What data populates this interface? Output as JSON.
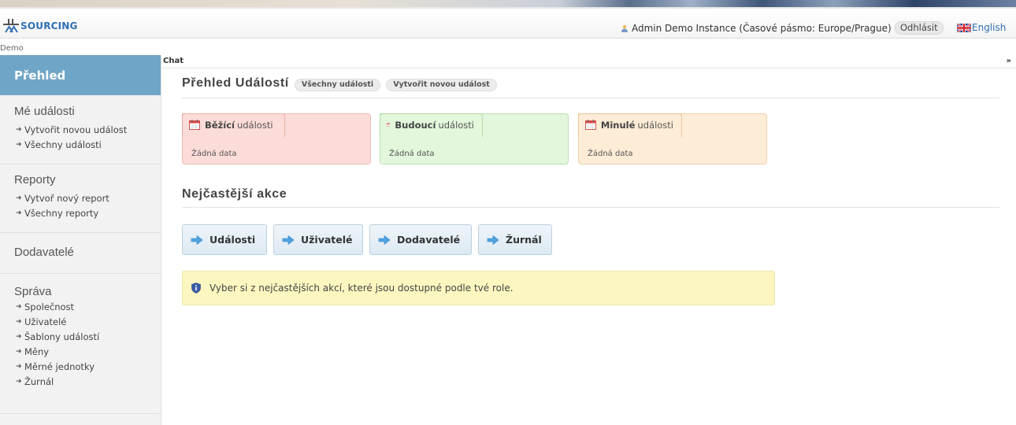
{
  "header": {
    "logo_text": "SOURCING",
    "user_info": "Admin Demo Instance (Časové pásmo: Europe/Prague)",
    "logout_label": "Odhlásit",
    "language_label": "English"
  },
  "instance_label": "Demo",
  "sidebar": {
    "overview_label": "Přehled",
    "my_events": {
      "title": "Mé události",
      "links": [
        "Vytvořit novou událost",
        "Všechny události"
      ]
    },
    "reports": {
      "title": "Reporty",
      "links": [
        "Vytvoř nový report",
        "Všechny reporty"
      ]
    },
    "suppliers": {
      "title": "Dodavatelé"
    },
    "admin": {
      "title": "Správa",
      "links": [
        "Společnost",
        "Uživatelé",
        "Šablony událostí",
        "Měny",
        "Měrné jednotky",
        "Žurnál"
      ]
    }
  },
  "chat": {
    "label": "Chat",
    "toggle": "»"
  },
  "main": {
    "title": "Přehled Událostí",
    "all_events_pill": "Všechny události",
    "create_event_pill": "Vytvořit novou událost",
    "event_boxes": {
      "running": {
        "bold": "Běžící",
        "rest": "události",
        "empty": "Žádná data"
      },
      "future": {
        "bold": "Budoucí",
        "rest": "události",
        "empty": "Žádná data"
      },
      "past": {
        "bold": "Minulé",
        "rest": "události",
        "empty": "Žádná data"
      }
    },
    "actions_title": "Nejčastější akce",
    "actions": [
      "Události",
      "Uživatelé",
      "Dodavatelé",
      "Žurnál"
    ],
    "notice": "Vyber si z nejčastějších akcí, které jsou dostupné podle tvé role."
  },
  "colors": {
    "sidebar_header": "#6fa6c7",
    "running": "#fcdcd8",
    "future": "#e2f7dc",
    "past": "#fdecd6",
    "notice": "#fcf7c0",
    "link": "#2f6fb3"
  }
}
